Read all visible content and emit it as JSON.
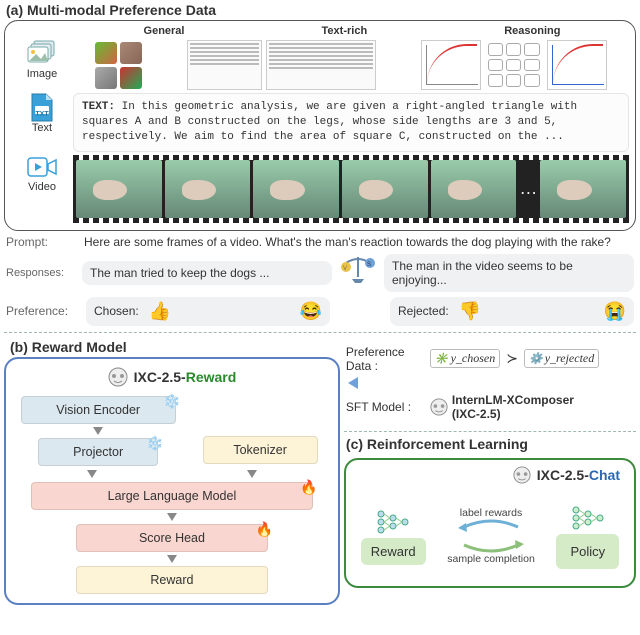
{
  "sections": {
    "a": {
      "title": "(a) Multi-modal Preference Data"
    },
    "b": {
      "title": "(b) Reward Model"
    },
    "c": {
      "title": "(c) Reinforcement Learning"
    }
  },
  "a": {
    "columns": {
      "general": "General",
      "textrich": "Text-rich",
      "reasoning": "Reasoning"
    },
    "rows": {
      "image": "Image",
      "text": "Text",
      "video": "Video"
    },
    "txt_badge": "TXT",
    "text_sample_prefix": "TEXT:",
    "text_sample": "In this geometric analysis, we are given a right-angled triangle with squares A and B constructed on the legs, whose side lengths are 3 and 5, respectively. We aim to find the area of square C, constructed on the ..."
  },
  "prompt": {
    "label": "Prompt:",
    "text": "Here are some frames of a video. What's the man's reaction towards the dog playing with the rake?"
  },
  "responses": {
    "label": "Responses:",
    "chosen": "The man tried to keep the dogs ...",
    "rejected": "The man in the video seems to be enjoying..."
  },
  "preference": {
    "label": "Preference:",
    "chosen": "Chosen:",
    "rejected": "Rejected:"
  },
  "b": {
    "name_prefix": "IXC-2.5-",
    "name_suffix": "Reward",
    "blocks": {
      "vision": "Vision Encoder",
      "projector": "Projector",
      "tokenizer": "Tokenizer",
      "llm": "Large Language Model",
      "score": "Score Head",
      "reward": "Reward"
    }
  },
  "right": {
    "pref_label": "Preference Data :",
    "y_chosen": "y_chosen",
    "succ": "≻",
    "y_rejected": "y_rejected",
    "sft_label": "SFT Model :",
    "sft_name_line1": "InternLM-XComposer",
    "sft_name_line2": "(IXC-2.5)"
  },
  "c": {
    "name_prefix": "IXC-2.5-",
    "name_suffix": "Chat",
    "lbl_rewards": "label rewards",
    "sample": "sample completion",
    "reward": "Reward",
    "policy": "Policy"
  }
}
